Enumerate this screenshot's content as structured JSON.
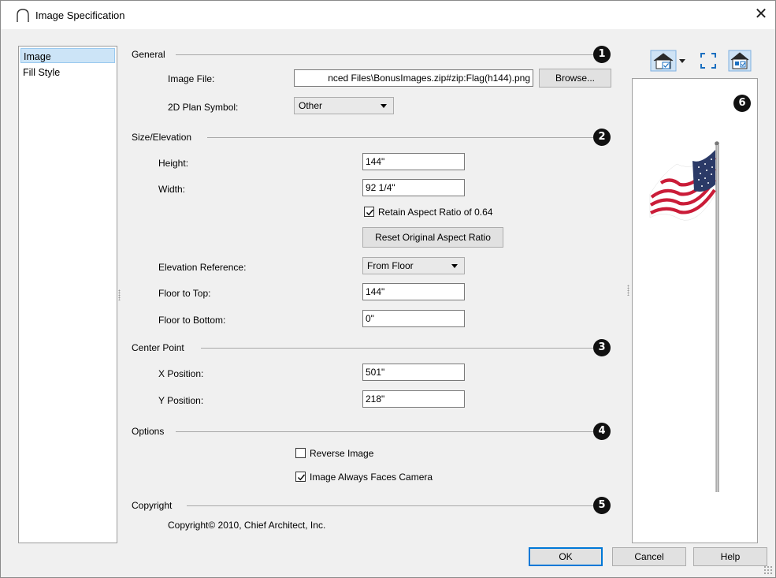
{
  "window": {
    "title": "Image Specification",
    "close_symbol": "✕",
    "icons": {
      "app": "chief-architect-arc-icon",
      "close": "close-icon"
    }
  },
  "nav": {
    "items": [
      {
        "label": "Image",
        "selected": true
      },
      {
        "label": "Fill Style",
        "selected": false
      }
    ]
  },
  "sections": {
    "general": {
      "label": "General",
      "badge": "1",
      "image_file_label": "Image File:",
      "image_file_value": "nced Files\\BonusImages.zip#zip:Flag(h144).png",
      "browse_label": "Browse...",
      "plan_symbol_label": "2D Plan Symbol:",
      "plan_symbol_value": "Other"
    },
    "size": {
      "label": "Size/Elevation",
      "badge": "2",
      "height_label": "Height:",
      "height_value": "144\"",
      "width_label": "Width:",
      "width_value": "92 1/4\"",
      "retain_label": "Retain Aspect Ratio of 0.64",
      "retain_checked": true,
      "reset_label": "Reset Original Aspect Ratio",
      "elev_ref_label": "Elevation Reference:",
      "elev_ref_value": "From Floor",
      "floor_top_label": "Floor to Top:",
      "floor_top_value": "144\"",
      "floor_bottom_label": "Floor to Bottom:",
      "floor_bottom_value": "0\""
    },
    "center": {
      "label": "Center Point",
      "badge": "3",
      "x_label": "X Position:",
      "x_value": "501\"",
      "y_label": "Y Position:",
      "y_value": "218\""
    },
    "options": {
      "label": "Options",
      "badge": "4",
      "reverse_label": "Reverse Image",
      "reverse_checked": false,
      "faces_label": "Image Always Faces Camera",
      "faces_checked": true
    },
    "copyright": {
      "label": "Copyright",
      "badge": "5",
      "text": "Copyright© 2010, Chief Architect, Inc."
    }
  },
  "preview": {
    "badge": "6",
    "toolbar_icons": [
      "house-view-dropdown-icon",
      "fit-to-view-icon",
      "render-preview-icon"
    ],
    "image": "american-flag-on-pole"
  },
  "footer": {
    "ok": "OK",
    "cancel": "Cancel",
    "help": "Help"
  },
  "colors": {
    "dialog_bg": "#f0f0f0",
    "selection": "#cce4f7",
    "default_button_border": "#0078d7",
    "badge": "#111111"
  }
}
